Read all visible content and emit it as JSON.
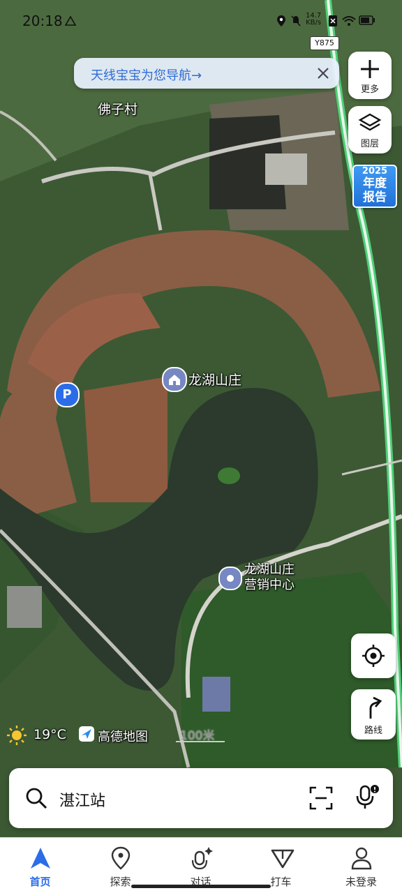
{
  "status_bar": {
    "time": "20:18",
    "net_speed": "14.7",
    "net_unit": "KB/s"
  },
  "banner": {
    "text": "天线宝宝为您导航→"
  },
  "map": {
    "road_shield": "Y875",
    "village_label": "佛子村",
    "poi_main": "龙湖山庄",
    "poi_sales_line1": "龙湖山庄",
    "poi_sales_line2": "营销中心",
    "weather_temp": "19°C",
    "brand": "高德地图",
    "scale": "100米",
    "colors": {
      "water": "#2d3b2e",
      "forest": "#2f5a2a",
      "roofs": "#9a5a3e",
      "road_green": "#4fcf78"
    }
  },
  "right_controls": {
    "more_label": "更多",
    "layers_label": "图层",
    "report_year": "2025",
    "report_line1": "年度",
    "report_line2": "报告",
    "route_label": "路线"
  },
  "search": {
    "value": "湛江站"
  },
  "nav": {
    "items": [
      {
        "label": "首页",
        "icon": "navigation-arrow-icon"
      },
      {
        "label": "探索",
        "icon": "location-pin-icon"
      },
      {
        "label": "对话",
        "icon": "microphone-sparkle-icon"
      },
      {
        "label": "打车",
        "icon": "taxi-icon"
      },
      {
        "label": "未登录",
        "icon": "user-icon"
      }
    ],
    "active_color": "#2b6de8"
  }
}
